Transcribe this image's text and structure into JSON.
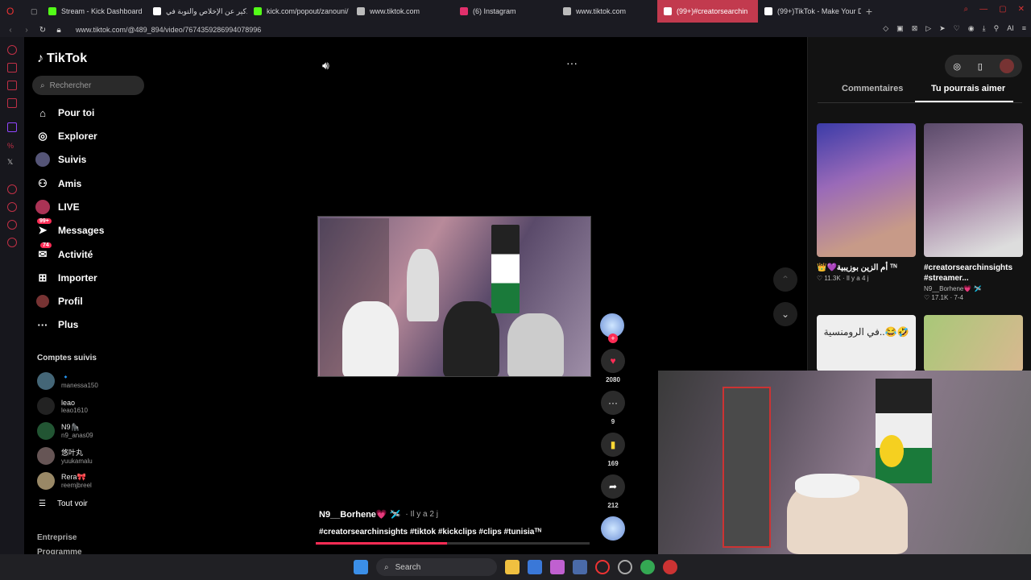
{
  "browser": {
    "tabs": [
      {
        "label": "Stream - Kick Dashboard",
        "color": "#53fc18"
      },
      {
        "label": "تذكير عن الإخلاص والتوبة في",
        "color": "#ffffff"
      },
      {
        "label": "kick.com/popout/zanouni/",
        "color": "#53fc18"
      },
      {
        "label": "www.tiktok.com",
        "color": "#bbbbbb"
      },
      {
        "label": "(6) Instagram",
        "color": "#e1306c"
      },
      {
        "label": "www.tiktok.com",
        "color": "#bbbbbb"
      },
      {
        "label": "(99+)#creatorsearchin",
        "color": "#ffffff",
        "active": true
      },
      {
        "label": "(99+)TikTok - Make Your D",
        "color": "#ffffff"
      }
    ],
    "url": "www.tiktok.com/@489_894/video/7674359286994078996",
    "ai_label": "AI"
  },
  "sidebar": {
    "logo": "TikTok",
    "search_placeholder": "Rechercher",
    "nav": [
      {
        "label": "Pour toi",
        "icon": "home-icon"
      },
      {
        "label": "Explorer",
        "icon": "compass-icon"
      },
      {
        "label": "Suivis",
        "icon": "following-avatar-icon"
      },
      {
        "label": "Amis",
        "icon": "friends-icon"
      },
      {
        "label": "LIVE",
        "icon": "live-icon"
      },
      {
        "label": "Messages",
        "icon": "messages-icon",
        "badge": "99+"
      },
      {
        "label": "Activité",
        "icon": "activity-icon",
        "badge": "74"
      },
      {
        "label": "Importer",
        "icon": "upload-icon"
      },
      {
        "label": "Profil",
        "icon": "profile-icon"
      },
      {
        "label": "Plus",
        "icon": "more-icon"
      }
    ],
    "followed_title": "Comptes suivis",
    "followed": [
      {
        "name": "🔹",
        "handle": "manessa150"
      },
      {
        "name": "leao",
        "handle": "leao1610"
      },
      {
        "name": "N9🦍",
        "handle": "n9_anas09"
      },
      {
        "name": "悠叶丸",
        "handle": "yuukamalu"
      },
      {
        "name": "Rera🎀",
        "handle": "reemjbreel"
      }
    ],
    "see_all": "Tout voir",
    "footer": [
      "Entreprise",
      "Programme"
    ]
  },
  "video": {
    "author": "N9__Borhene💗 🛩️",
    "time": "· Il y a 2 j",
    "tags": "#creatorsearchinsights #tiktok #kickclips #clips #tunisiaᵀᴺ",
    "progress": 0.48,
    "likes": "2080",
    "comments": "9",
    "saves": "169",
    "shares": "212"
  },
  "right_panel": {
    "tabs": [
      "Commentaires",
      "Tu pourrais aimer"
    ],
    "cards": [
      {
        "title": "👑💜أم الزين بوزيبية ᵀᴺ",
        "meta_likes": "11.3K",
        "meta_time": "Il y a 4 j",
        "thumb_color": "#6a4aa0"
      },
      {
        "title": "#creatorsearchinsights #streamer...",
        "author": "N9__Borhene💗 🛩️",
        "meta_likes": "17.1K",
        "meta_time": "7-4",
        "thumb_color": "#7a5a80"
      },
      {
        "title": "في الرومنسية..😂🤣",
        "thumb_color": "#d8c9a8"
      },
      {
        "title": "",
        "thumb_color": "#b89a70"
      }
    ]
  },
  "taskbar": {
    "search_label": "Search"
  }
}
